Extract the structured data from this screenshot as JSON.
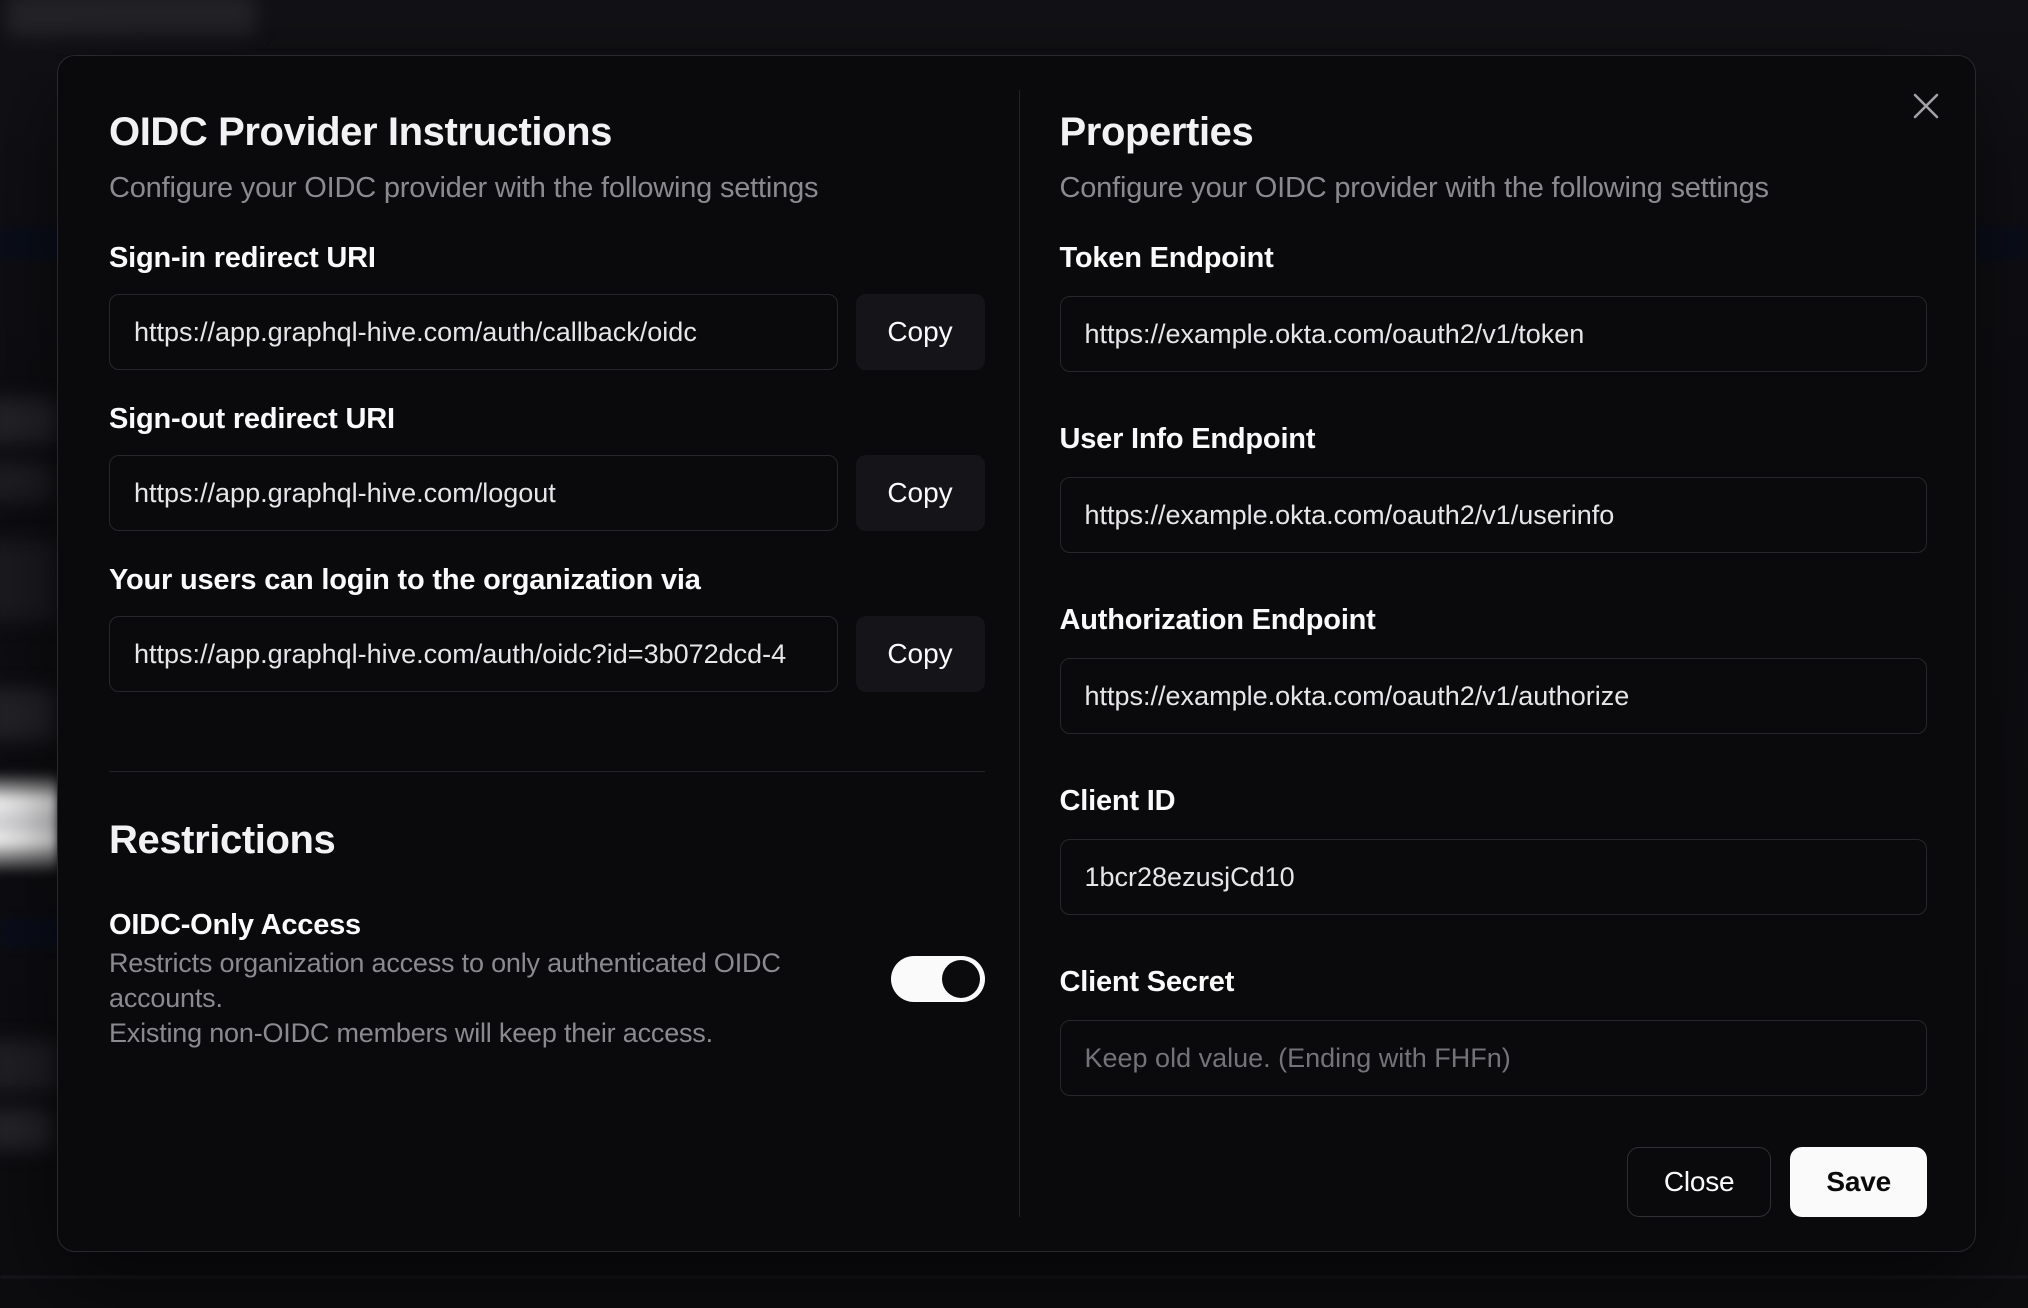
{
  "modal": {
    "left": {
      "title": "OIDC Provider Instructions",
      "subtitle": "Configure your OIDC provider with the following settings",
      "fields": [
        {
          "label": "Sign-in redirect URI",
          "value": "https://app.graphql-hive.com/auth/callback/oidc",
          "action": "Copy"
        },
        {
          "label": "Sign-out redirect URI",
          "value": "https://app.graphql-hive.com/logout",
          "action": "Copy"
        },
        {
          "label": "Your users can login to the organization via",
          "value": "https://app.graphql-hive.com/auth/oidc?id=3b072dcd-4",
          "action": "Copy"
        }
      ],
      "restrictions": {
        "title": "Restrictions",
        "toggle_label": "OIDC-Only Access",
        "toggle_description_line1": "Restricts organization access to only authenticated OIDC accounts.",
        "toggle_description_line2": "Existing non-OIDC members will keep their access.",
        "toggle_state": "on"
      }
    },
    "right": {
      "title": "Properties",
      "subtitle": "Configure your OIDC provider with the following settings",
      "fields": [
        {
          "label": "Token Endpoint",
          "value": "https://example.okta.com/oauth2/v1/token"
        },
        {
          "label": "User Info Endpoint",
          "value": "https://example.okta.com/oauth2/v1/userinfo"
        },
        {
          "label": "Authorization Endpoint",
          "value": "https://example.okta.com/oauth2/v1/authorize"
        },
        {
          "label": "Client ID",
          "value": "1bcr28ezusjCd10"
        },
        {
          "label": "Client Secret",
          "value": "",
          "placeholder": "Keep old value. (Ending with FHFn)"
        }
      ],
      "buttons": {
        "close": "Close",
        "save": "Save"
      }
    },
    "colors": {
      "modal_background": "#0a0a0d",
      "input_border": "#27272b",
      "copy_button_background": "#151519",
      "save_button_background": "#fafafa",
      "toggle_track_on": "#fafafa",
      "toggle_thumb": "#0b0b0e"
    }
  }
}
